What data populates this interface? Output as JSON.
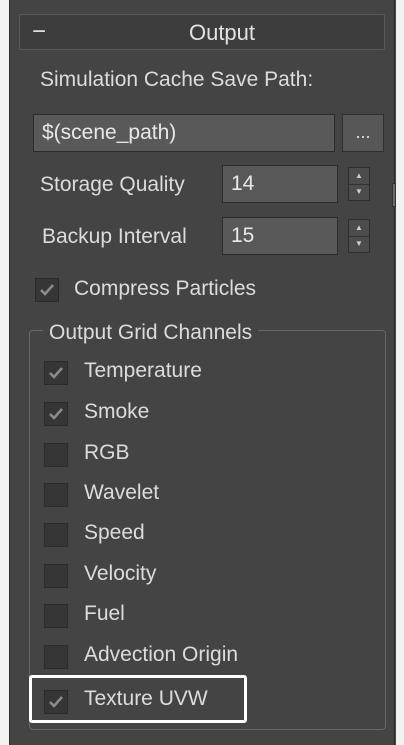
{
  "rollout": {
    "toggle": "−",
    "title": "Output"
  },
  "cache_path": {
    "label": "Simulation Cache Save Path:",
    "value": "$(scene_path)",
    "browse_label": "..."
  },
  "storage_quality": {
    "label": "Storage Quality",
    "value": "14"
  },
  "backup_interval": {
    "label": "Backup Interval",
    "value": "15"
  },
  "compress_particles": {
    "label": "Compress Particles",
    "checked": true
  },
  "grid_channels": {
    "title": "Output Grid Channels",
    "items": [
      {
        "label": "Temperature",
        "checked": true
      },
      {
        "label": "Smoke",
        "checked": true
      },
      {
        "label": "RGB",
        "checked": false
      },
      {
        "label": "Wavelet",
        "checked": false
      },
      {
        "label": "Speed",
        "checked": false
      },
      {
        "label": "Velocity",
        "checked": false
      },
      {
        "label": "Fuel",
        "checked": false
      },
      {
        "label": "Advection Origin",
        "checked": false
      },
      {
        "label": "Texture UVW",
        "checked": true
      }
    ]
  },
  "colors": {
    "background": "#444444",
    "field": "#595959",
    "highlight": "#ffffff"
  }
}
